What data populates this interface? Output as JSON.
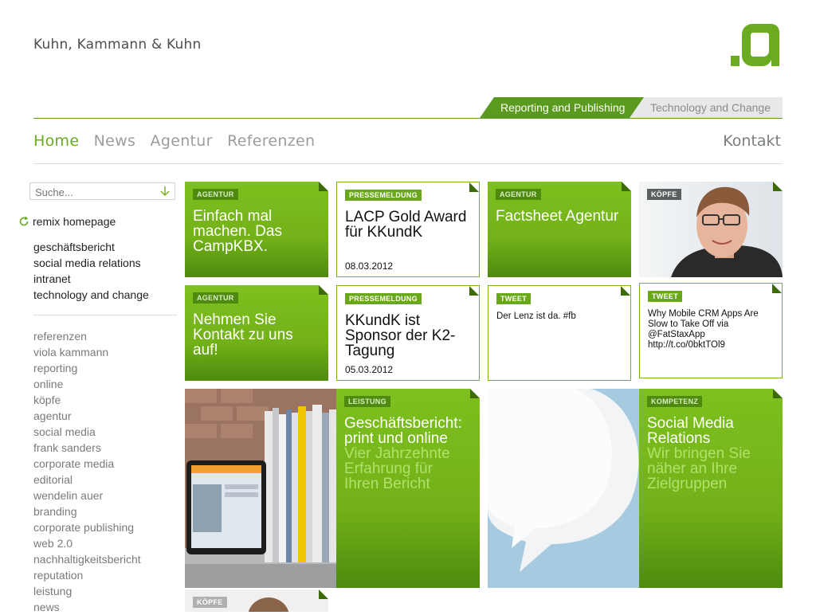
{
  "logo": "Kuhn, Kammann & Kuhn",
  "tabs": {
    "active": "Reporting and Publishing",
    "inactive": "Technology and Change"
  },
  "nav": {
    "items": [
      "Home",
      "News",
      "Agentur",
      "Referenzen"
    ],
    "kontakt": "Kontakt"
  },
  "search": {
    "placeholder": "Suche..."
  },
  "sidebar": {
    "remix": "remix homepage",
    "primary": [
      "geschäftsbericht",
      "social media relations",
      "intranet",
      "technology and change"
    ],
    "secondary": [
      "referenzen",
      "viola kammann",
      "reporting",
      "online",
      "köpfe",
      "agentur",
      "social media",
      "frank sanders",
      "corporate media",
      "editorial",
      "wendelin auer",
      "branding",
      "corporate publishing",
      "web 2.0",
      "nachhaltigkeitsbericht",
      "reputation",
      "leistung",
      "news"
    ]
  },
  "tiles": {
    "t1": {
      "tag": "AGENTUR",
      "title": "Einfach mal machen. Das CampKBX."
    },
    "t2": {
      "tag": "PRESSEMELDUNG",
      "title": "LACP Gold Award für KKundK",
      "date": "08.03.2012"
    },
    "t3": {
      "tag": "AGENTUR",
      "title": "Factsheet Agentur"
    },
    "t4": {
      "tag": "KÖPFE"
    },
    "t5": {
      "tag": "AGENTUR",
      "title": "Nehmen Sie Kontakt zu uns auf!"
    },
    "t6": {
      "tag": "PRESSEMELDUNG",
      "title": "KKundK ist Sponsor der K2-Tagung",
      "date": "05.03.2012"
    },
    "t7": {
      "tag": "TWEET",
      "text": "Der Lenz ist da. #fb"
    },
    "t8": {
      "tag": "TWEET",
      "text": "Why Mobile CRM Apps Are Slow to Take Off via @FatStaxApp http://t.co/0bktTOl9"
    },
    "t9": {
      "tag": "LEISTUNG",
      "title": "Geschäftsbericht: print und online",
      "sub": "Vier Jahrzehnte Erfahrung für Ihren Bericht"
    },
    "t10": {
      "tag": "KOMPETENZ",
      "title": "Social Media Relations",
      "sub": "Wir bringen Sie näher an Ihre Zielgruppen"
    },
    "t11": {
      "tag": "KÖPFE"
    }
  },
  "colors": {
    "accent": "#6aab1f",
    "tile_green": "#72b118",
    "tab_active": "#5a9a1e"
  }
}
